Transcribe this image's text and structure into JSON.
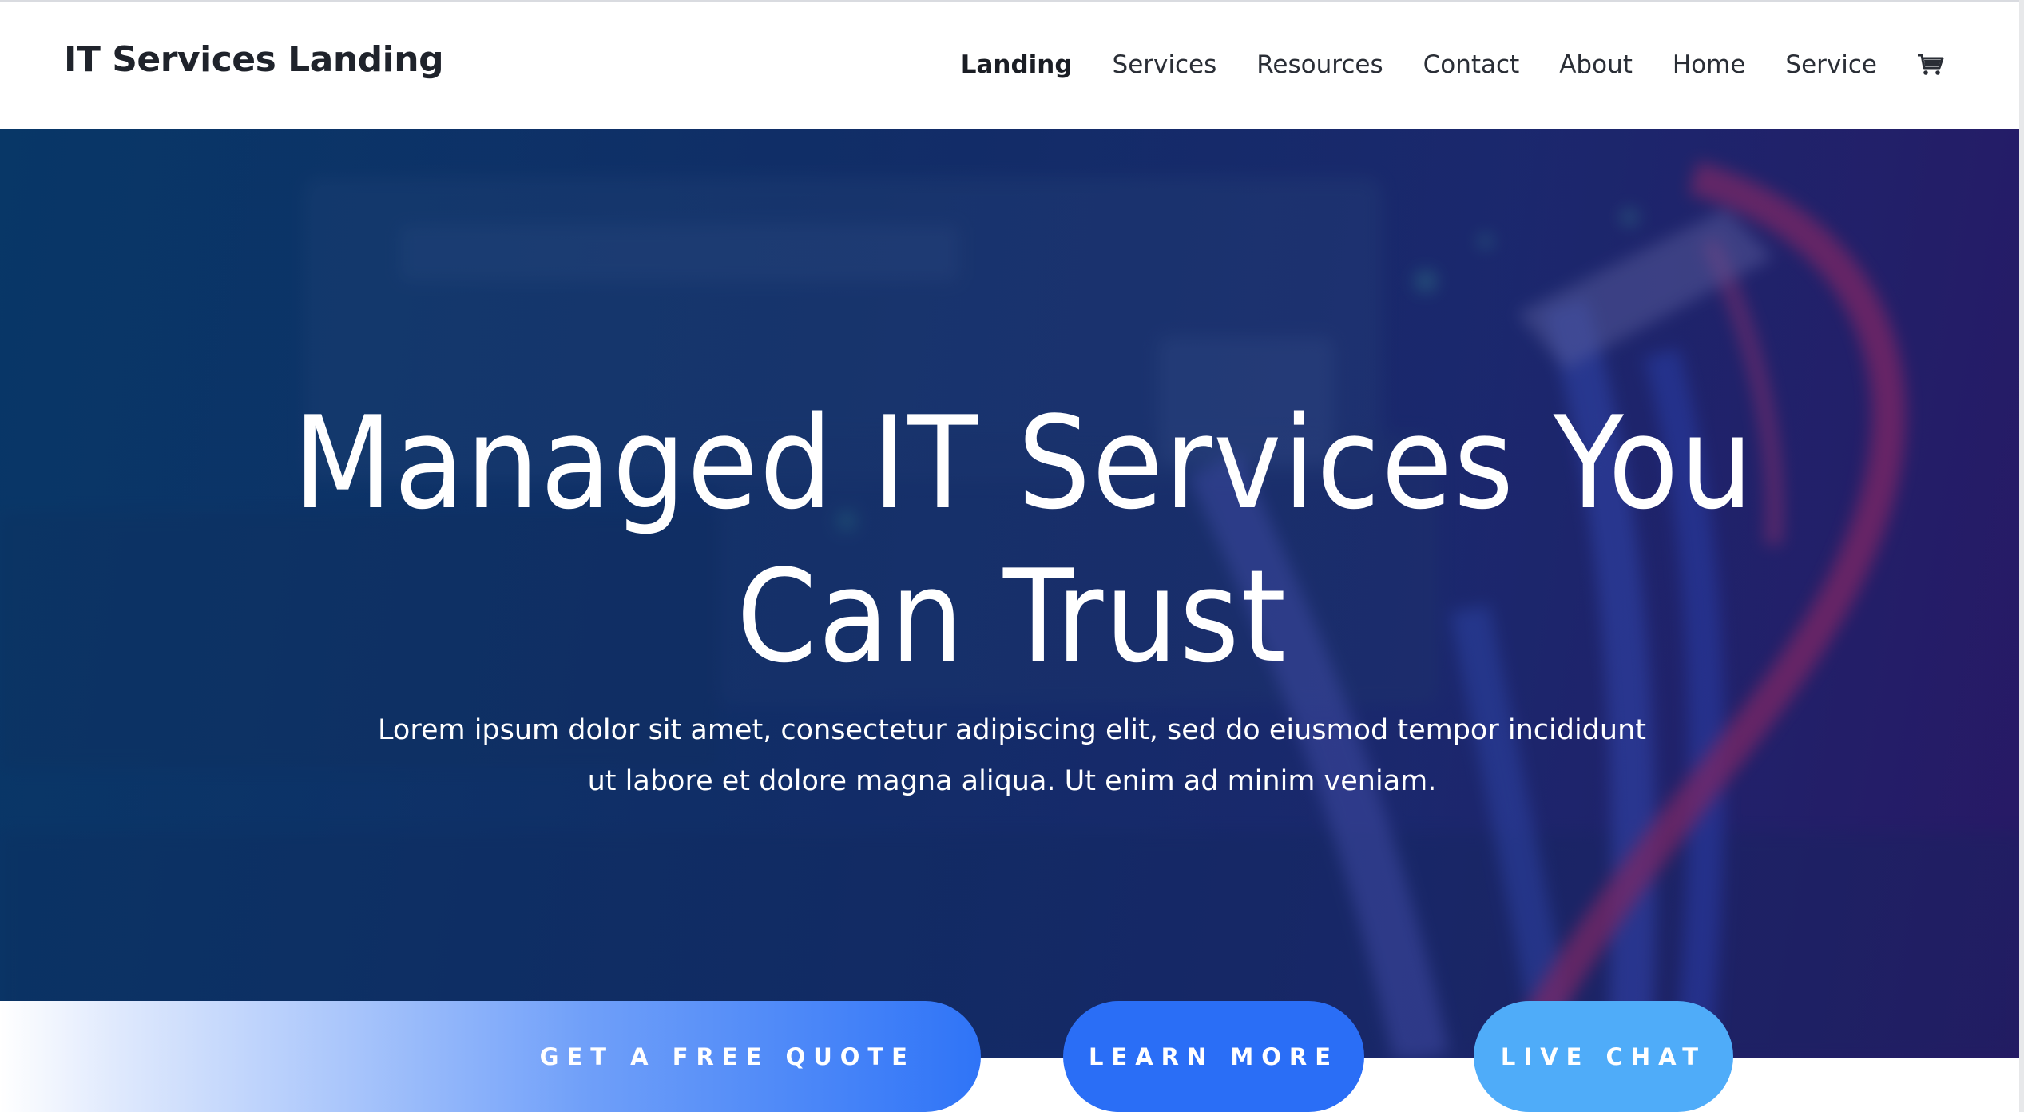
{
  "header": {
    "logo": "IT Services Landing",
    "nav": [
      {
        "label": "Landing",
        "active": true
      },
      {
        "label": "Services",
        "active": false
      },
      {
        "label": "Resources",
        "active": false
      },
      {
        "label": "Contact",
        "active": false
      },
      {
        "label": "About",
        "active": false
      },
      {
        "label": "Home",
        "active": false
      },
      {
        "label": "Service",
        "active": false
      }
    ],
    "cart_icon": "shopping-cart-icon"
  },
  "hero": {
    "title_line1": "Managed IT Services You",
    "title_line2": "Can Trust",
    "subtitle": "Lorem ipsum dolor sit amet, consectetur adipiscing elit, sed do eiusmod tempor incididunt ut labore et dolore magna aliqua. Ut enim ad minim veniam."
  },
  "cta": {
    "quote": "GET A FREE QUOTE",
    "learn": "LEARN MORE",
    "chat": "LIVE CHAT"
  },
  "colors": {
    "hero_start": "#0b3b6b",
    "hero_end": "#281b66",
    "learn_more": "#2a6ef6",
    "live_chat": "#4facf9",
    "quote_end": "#2f74f7",
    "text_dark": "#1f232b"
  }
}
